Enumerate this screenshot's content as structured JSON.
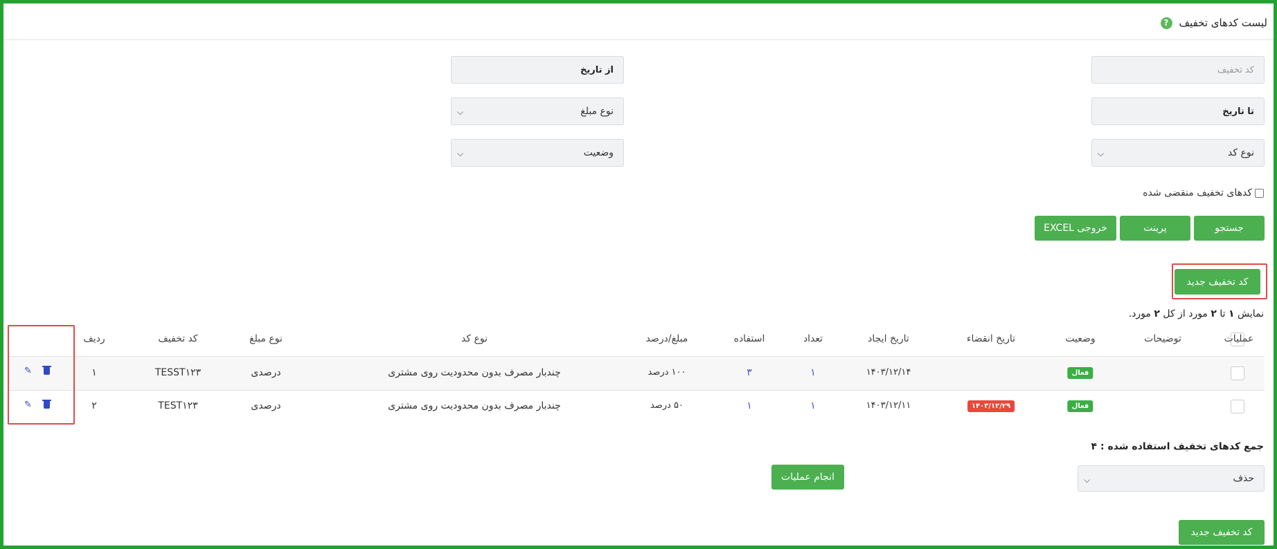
{
  "page": {
    "title": "لیست کدهای تخفیف",
    "help_icon": "?"
  },
  "filters": {
    "code_placeholder": "کد تخفیف",
    "from_date": "از تاریخ",
    "to_date": "تا تاریخ",
    "amount_type": "نوع مبلغ",
    "code_type": "نوع کد",
    "status": "وضعیت",
    "expired_label": "کدهای تخفیف منقضی شده"
  },
  "actions": {
    "search": "جستجو",
    "print": "پرینت",
    "excel": "خروجی EXCEL",
    "new_code": "کد تخفیف جدید"
  },
  "summary": {
    "prefix": "نمایش ",
    "from": "۱",
    "to_word": " تا ",
    "to": "۲",
    "middle": " مورد از کل ",
    "total": "۲",
    "suffix": " مورد."
  },
  "table": {
    "headers": {
      "row": "ردیف",
      "code": "کد تخفیف",
      "amount_type": "نوع مبلغ",
      "code_type": "نوع کد",
      "amount": "مبلغ/درصد",
      "usage": "استفاده",
      "count": "تعداد",
      "created": "تاریخ ایجاد",
      "expire": "تاریخ انقضاء",
      "status": "وضعیت",
      "description": "توضیحات",
      "operations": "عملیات"
    },
    "rows": [
      {
        "row": "۱",
        "code": "TESST۱۲۳",
        "amount_type": "درصدی",
        "code_type": "چندبار مصرف بدون محدودیت روی مشتری",
        "amount": "۱۰۰ درصد",
        "usage": "۳",
        "count": "۱",
        "created": "۱۴۰۳/۱۲/۱۴",
        "expire": "",
        "status": "فعال",
        "description": ""
      },
      {
        "row": "۲",
        "code": "TEST۱۲۳",
        "amount_type": "درصدی",
        "code_type": "چندبار مصرف بدون محدودیت روی مشتری",
        "amount": "۵۰ درصد",
        "usage": "۱",
        "count": "۱",
        "created": "۱۴۰۳/۱۲/۱۱",
        "expire": "۱۴۰۳/۱۲/۲۹",
        "status": "فعال",
        "description": ""
      }
    ]
  },
  "footer": {
    "total_used": "جمع کدهای تخفیف استفاده شده : ۴",
    "bulk_action_selected": "حذف",
    "perform": "انجام عملیات"
  },
  "colors": {
    "primary_green": "#4caf50",
    "frame_green": "#22a330",
    "highlight_red": "#e04b4b",
    "link_blue": "#3b55c7",
    "badge_red": "#e64a3b"
  },
  "icons": {
    "edit": "edit-icon",
    "delete": "trash-icon",
    "help": "help-icon",
    "dropdown": "chevron-down-icon"
  }
}
